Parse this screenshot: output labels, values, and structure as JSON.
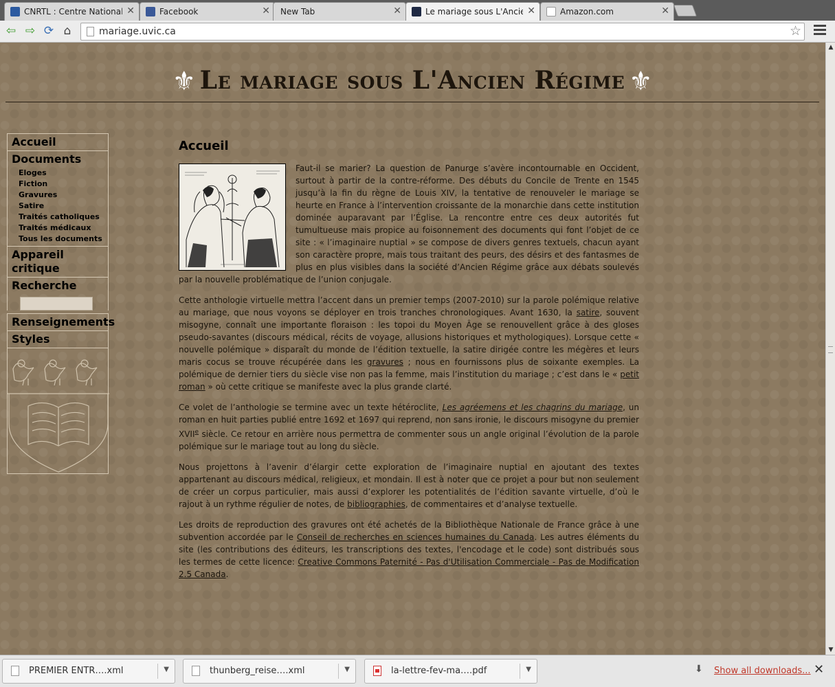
{
  "browser": {
    "tabs": [
      {
        "title": "CNRTL : Centre National de",
        "favicon": "cnrtl-icon",
        "active": false
      },
      {
        "title": "Facebook",
        "favicon": "facebook-icon",
        "active": false
      },
      {
        "title": "New Tab",
        "favicon": "",
        "active": false
      },
      {
        "title": "Le mariage sous L'Ancien R",
        "favicon": "site-icon",
        "active": true
      },
      {
        "title": "Amazon.com",
        "favicon": "amazon-icon",
        "active": false
      }
    ],
    "close_glyph": "✕",
    "url": "mariage.uvic.ca"
  },
  "site": {
    "title": "Le mariage sous L'Ancien Régime",
    "fleur": "⚜"
  },
  "sidebar": {
    "home": "Accueil",
    "documents": "Documents",
    "document_items": [
      "Eloges",
      "Fiction",
      "Gravures",
      "Satire",
      "Traités catholiques",
      "Traités médicaux",
      "Tous les documents"
    ],
    "appareil": "Appareil critique",
    "recherche": "Recherche",
    "search_placeholder": "",
    "renseignements": "Renseignements",
    "styles": "Styles"
  },
  "content": {
    "heading": "Accueil",
    "p1": "Faut-il se marier? La question de Panurge s’avère incontournable en Occident, surtout à partir de la contre-réforme. Des débuts du Concile de Trente en 1545 jusqu’à la fin du règne de Louis XIV, la tentative de renouveler le mariage se heurte en France à l’intervention croissante de la monarchie dans cette institution dominée auparavant par l’Église. La rencontre entre ces deux autorités fut tumultueuse mais propice au foisonnement des documents qui font l’objet de ce site : « l’imaginaire nuptial » se compose de divers genres textuels, chacun ayant son caractère propre, mais tous traitant des peurs, des désirs et des fantasmes de plus en plus visibles dans la société d’Ancien Régime grâce aux débats soulevés par la nouvelle problématique de l’union conjugale.",
    "p2a": "Cette anthologie virtuelle mettra l’accent dans un premier temps (2007-2010) sur la parole polémique relative au mariage, que nous voyons se déployer en trois tranches chronologiques. Avant 1630, la ",
    "p2_link1": "satire",
    "p2b": ", souvent misogyne, connaît une importante floraison : les topoi du Moyen Âge se renouvellent grâce à des gloses pseudo-savantes (discours médical, récits de voyage, allusions historiques et mythologiques). Lorsque cette « nouvelle polémique » disparaît du monde de l’édition textuelle, la satire dirigée contre les mégères et leurs maris cocus se trouve récupérée dans les ",
    "p2_link2": "gravures",
    "p2c": " ; nous en fournissons plus de soixante exemples. La polémique de dernier tiers du siècle vise non pas la femme, mais l’institution du mariage ; c’est dans le « ",
    "p2_link3": "petit roman",
    "p2d": " » où cette critique se manifeste avec la plus grande clarté.",
    "p3a": "Ce volet de l’anthologie se termine avec un texte hétéroclite, ",
    "p3_link": "Les agréemens et les chagrins du mariage",
    "p3b": ", un roman en huit parties publié entre 1692 et 1697 qui reprend, non sans ironie, le discours misogyne du premier XVII",
    "p3_sup": "e",
    "p3c": " siècle. Ce retour en arrière nous permettra de commenter sous un angle original l’évolution de la parole polémique sur le mariage tout au long du siècle.",
    "p4a": "Nous projettons à l’avenir d’élargir cette exploration de l’imaginaire nuptial en ajoutant des textes appartenant au discours médical, religieux, et mondain. Il est à noter que ce projet a pour but non seulement de créer un corpus particulier, mais aussi d’explorer les potentialités de l’édition savante virtuelle, d’où le rajout à un rythme régulier de notes, de ",
    "p4_link": "bibliographies",
    "p4b": ", de commentaires et d’analyse textuelle.",
    "p5a": "Les droits de reproduction des gravures ont été achetés de la Bibliothèque Nationale de France grâce à une subvention accordée par le ",
    "p5_link1": "Conseil de recherches en sciences humaines du Canada",
    "p5b": ". Les autres éléments du site (les contributions des éditeurs, les transcriptions des textes, l'encodage et le code) sont distribués sous les termes de cette licence: ",
    "p5_link2": "Creative Commons Paternité - Pas d'Utilisation Commerciale - Pas de Modification 2.5 Canada",
    "p5c": "."
  },
  "downloads": {
    "items": [
      {
        "name": "PREMIER ENTR….xml",
        "type": "xml"
      },
      {
        "name": "thunberg_reise….xml",
        "type": "xml"
      },
      {
        "name": "la-lettre-fev-ma….pdf",
        "type": "pdf"
      }
    ],
    "caret": "▼",
    "show_all": "Show all downloads...",
    "close": "✕"
  },
  "colors": {
    "page_background": "#8c7a61",
    "title_text": "#1d150c",
    "download_link": "#c0392b"
  }
}
